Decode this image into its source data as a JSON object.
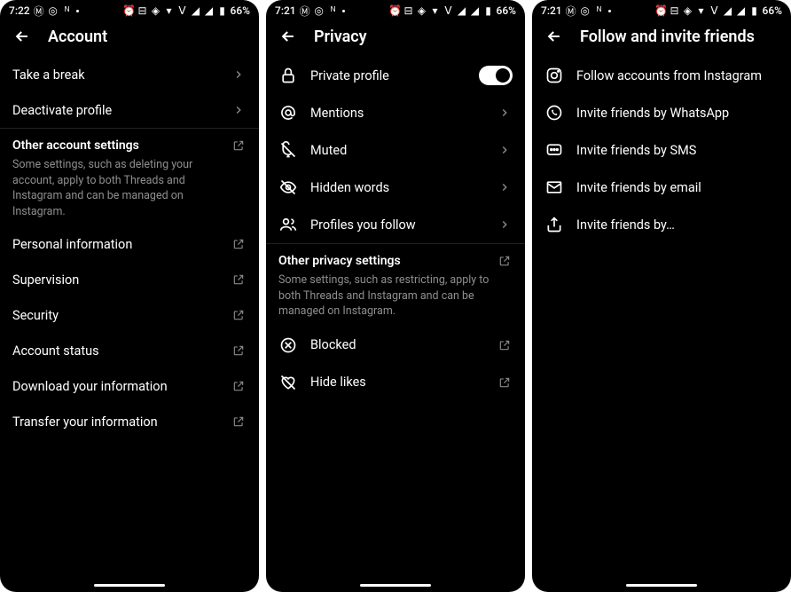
{
  "status": {
    "time1": "7:22",
    "time2": "7:21",
    "time3": "7:21",
    "battery": "66%"
  },
  "screen1": {
    "title": "Account",
    "items": [
      {
        "label": "Take a break",
        "trailing": "chevron"
      },
      {
        "label": "Deactivate profile",
        "trailing": "chevron"
      }
    ],
    "section": {
      "title": "Other account settings",
      "desc": "Some settings, such as deleting your account, apply to both Threads and Instagram and can be managed on Instagram."
    },
    "items2": [
      {
        "label": "Personal information",
        "trailing": "external"
      },
      {
        "label": "Supervision",
        "trailing": "external"
      },
      {
        "label": "Security",
        "trailing": "external"
      },
      {
        "label": "Account status",
        "trailing": "external"
      },
      {
        "label": "Download your information",
        "trailing": "external"
      },
      {
        "label": "Transfer your information",
        "trailing": "external"
      }
    ]
  },
  "screen2": {
    "title": "Privacy",
    "items": [
      {
        "icon": "lock",
        "label": "Private profile",
        "trailing": "toggle"
      },
      {
        "icon": "mention",
        "label": "Mentions",
        "trailing": "chevron"
      },
      {
        "icon": "muted",
        "label": "Muted",
        "trailing": "chevron"
      },
      {
        "icon": "hidden",
        "label": "Hidden words",
        "trailing": "chevron"
      },
      {
        "icon": "people",
        "label": "Profiles you follow",
        "trailing": "chevron"
      }
    ],
    "section": {
      "title": "Other privacy settings",
      "desc": "Some settings, such as restricting, apply to both Threads and Instagram and can be managed on Instagram."
    },
    "items2": [
      {
        "icon": "blocked",
        "label": "Blocked",
        "trailing": "external"
      },
      {
        "icon": "hidelikes",
        "label": "Hide likes",
        "trailing": "external"
      }
    ]
  },
  "screen3": {
    "title": "Follow and invite friends",
    "items": [
      {
        "icon": "instagram",
        "label": "Follow accounts from Instagram"
      },
      {
        "icon": "whatsapp",
        "label": "Invite friends by WhatsApp"
      },
      {
        "icon": "sms",
        "label": "Invite friends by SMS"
      },
      {
        "icon": "email",
        "label": "Invite friends by email"
      },
      {
        "icon": "share",
        "label": "Invite friends by…"
      }
    ]
  }
}
